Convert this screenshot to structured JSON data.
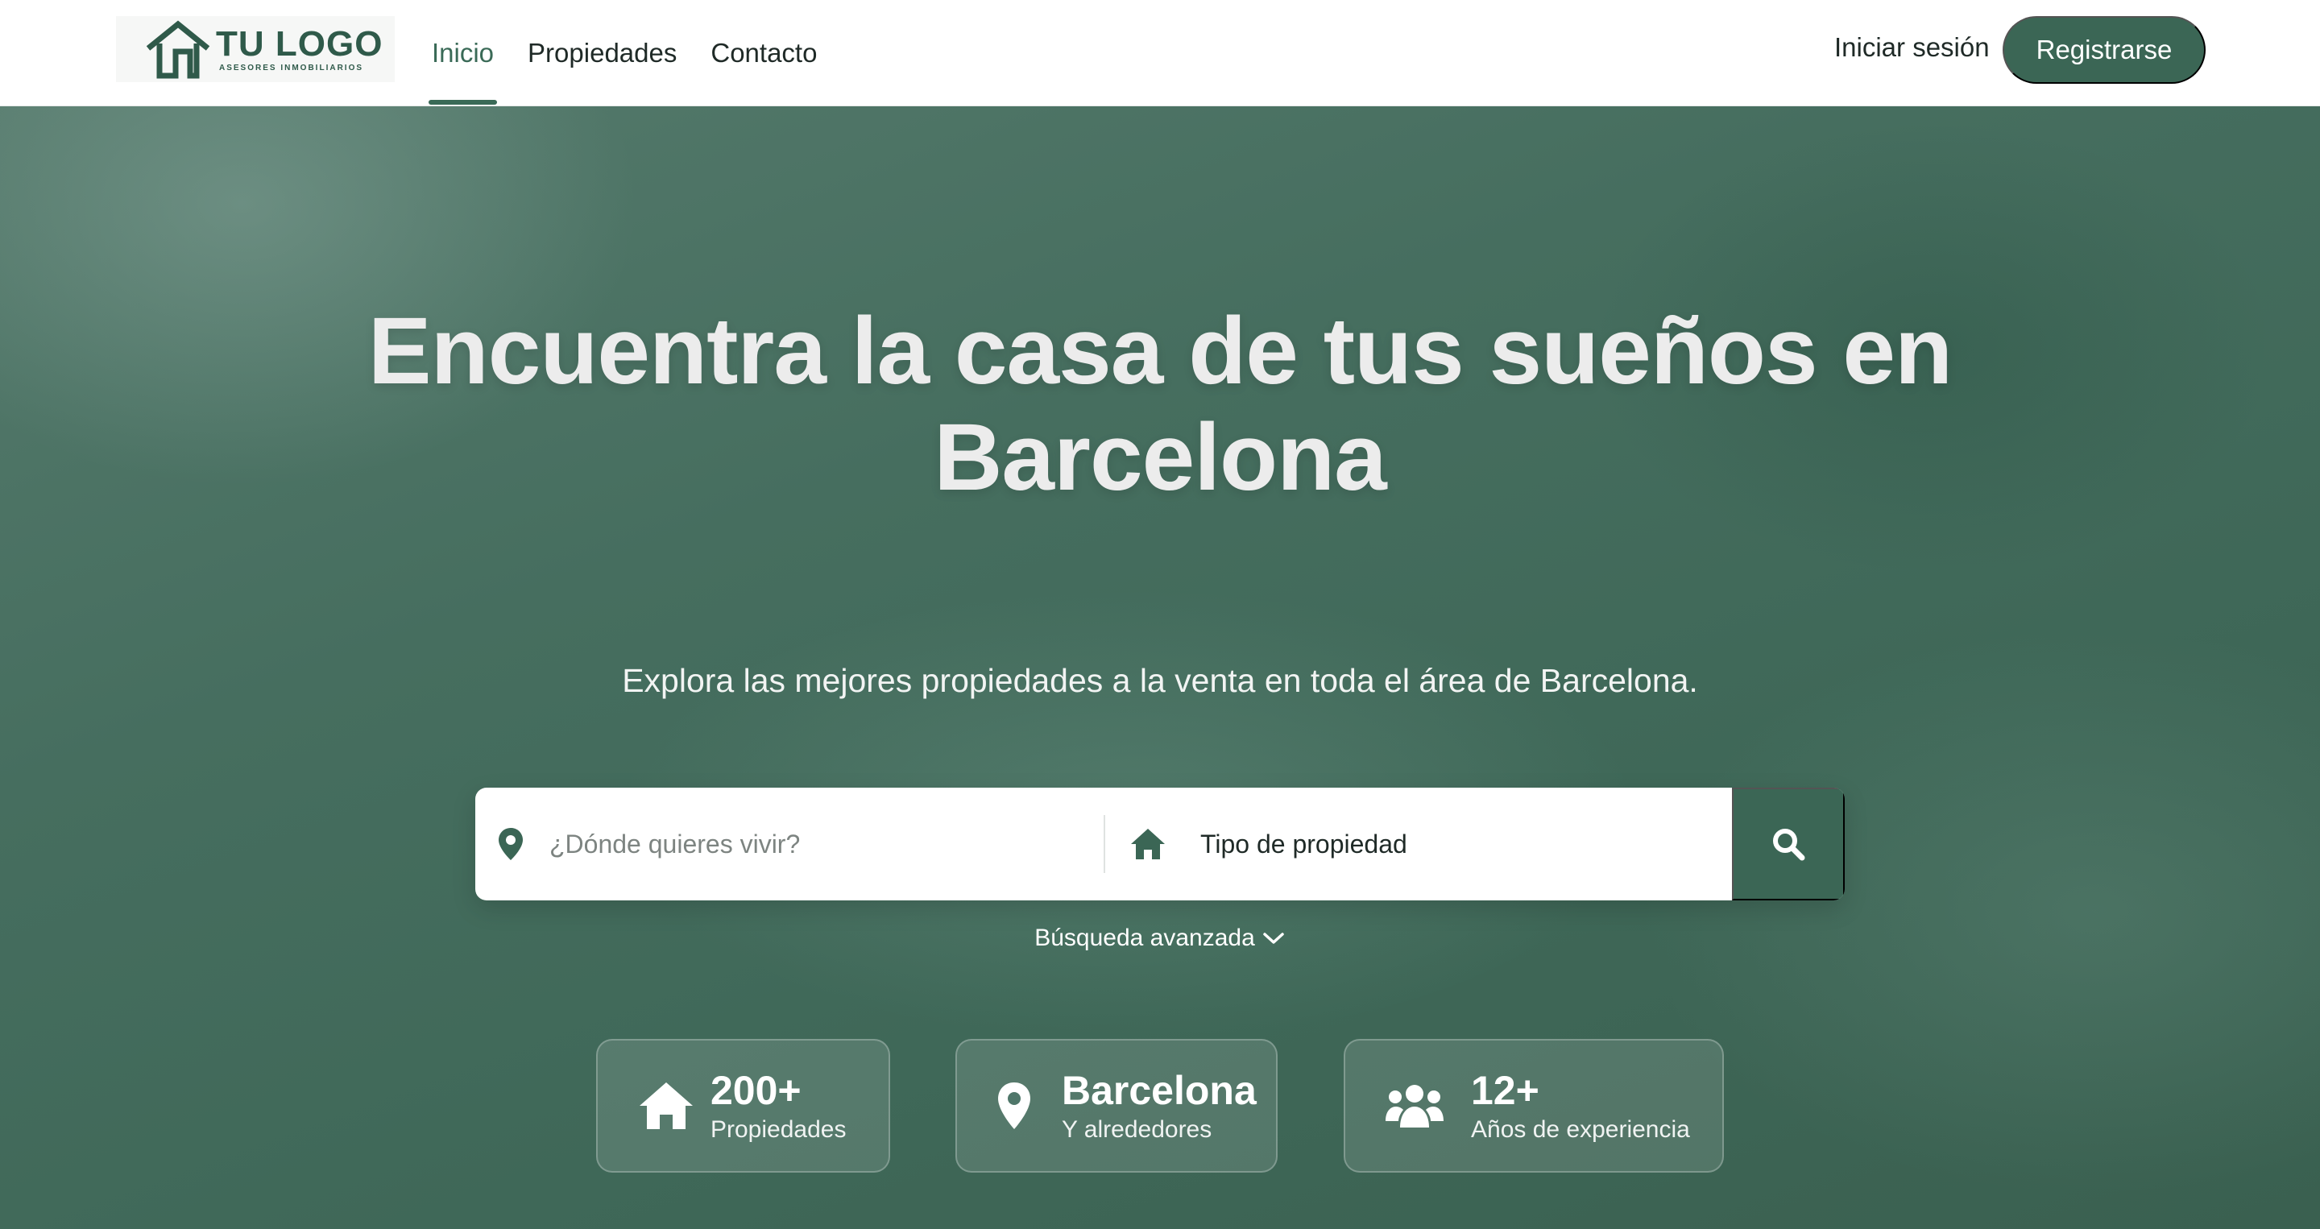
{
  "brand": {
    "logo_text": "TU LOGO",
    "logo_subtext": "ASESORES INMOBILIARIOS",
    "color": "#2f5a4a"
  },
  "nav": {
    "items": [
      {
        "label": "Inicio",
        "active": true
      },
      {
        "label": "Propiedades",
        "active": false
      },
      {
        "label": "Contacto",
        "active": false
      }
    ],
    "login_label": "Iniciar sesión",
    "register_label": "Registrarse"
  },
  "hero": {
    "title_line1": "Encuentra la casa de tus sueños en",
    "title_line2": "Barcelona",
    "subtitle": "Explora las mejores propiedades a la venta en toda el área de Barcelona."
  },
  "search": {
    "location_placeholder": "¿Dónde quieres vivir?",
    "location_value": "",
    "type_label": "Tipo de propiedad",
    "location_icon": "map-pin-icon",
    "type_icon": "house-icon",
    "button_icon": "search-icon",
    "advanced_label": "Búsqueda avanzada"
  },
  "stats": [
    {
      "icon": "house-icon",
      "value": "200+",
      "label": "Propiedades"
    },
    {
      "icon": "map-pin-icon",
      "value": "Barcelona",
      "label": "Y alrededores"
    },
    {
      "icon": "users-icon",
      "value": "12+",
      "label": "Años de experiencia"
    }
  ],
  "colors": {
    "accent": "#3b6655",
    "hero_bg": "#466e5f",
    "text_dark": "#1f2a27"
  }
}
